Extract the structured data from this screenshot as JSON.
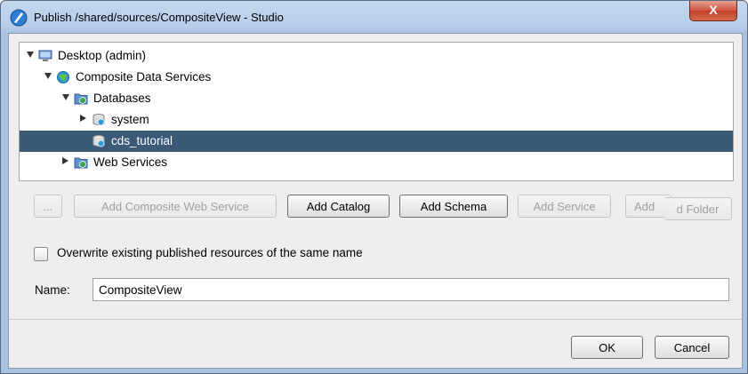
{
  "window": {
    "title": "Publish /shared/sources/CompositeView - Studio",
    "close_label": "X"
  },
  "tree": {
    "nodes": [
      {
        "label": "Desktop (admin)",
        "icon": "computer-icon",
        "expanded": true
      },
      {
        "label": "Composite Data Services",
        "icon": "globe-icon",
        "expanded": true
      },
      {
        "label": "Databases",
        "icon": "folder-icon",
        "expanded": true
      },
      {
        "label": "system",
        "icon": "database-icon",
        "expanded": false
      },
      {
        "label": "cds_tutorial",
        "icon": "database-icon",
        "selected": true
      },
      {
        "label": "Web Services",
        "icon": "folder-icon",
        "expanded": false
      }
    ]
  },
  "buttons": {
    "more": "...",
    "add_composite_web_service": "Add Composite Web Service",
    "add_catalog": "Add Catalog",
    "add_schema": "Add Schema",
    "add_service": "Add Service",
    "add_folder_partial_left": "Add",
    "add_folder_partial_right": "d Folder"
  },
  "options": {
    "overwrite_label": "Overwrite existing published resources of the same name",
    "overwrite_checked": false
  },
  "name_field": {
    "label": "Name:",
    "value": "CompositeView"
  },
  "footer": {
    "ok": "OK",
    "cancel": "Cancel"
  },
  "colors": {
    "selection": "#3a5a78",
    "titlebar": "#b6cce9",
    "close": "#c2412a"
  }
}
